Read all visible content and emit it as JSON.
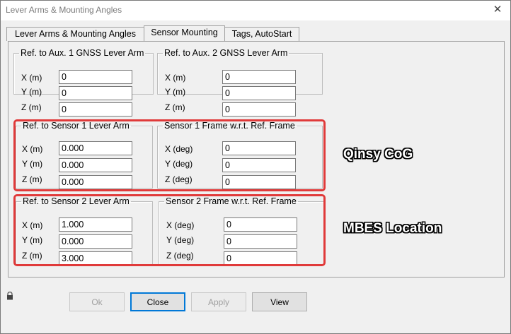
{
  "window": {
    "title": "Lever Arms & Mounting Angles",
    "close_glyph": "✕"
  },
  "tabs": [
    {
      "label": "Lever Arms & Mounting Angles",
      "active": false
    },
    {
      "label": "Sensor Mounting",
      "active": true
    },
    {
      "label": "Tags, AutoStart",
      "active": false
    }
  ],
  "groups": {
    "aux1": {
      "title": "Ref. to Aux. 1 GNSS Lever Arm",
      "rows": [
        {
          "label": "X (m)",
          "value": "0"
        },
        {
          "label": "Y (m)",
          "value": "0"
        },
        {
          "label": "Z (m)",
          "value": "0"
        }
      ]
    },
    "aux2": {
      "title": "Ref. to Aux. 2 GNSS Lever Arm",
      "rows": [
        {
          "label": "X (m)",
          "value": "0"
        },
        {
          "label": "Y (m)",
          "value": "0"
        },
        {
          "label": "Z (m)",
          "value": "0"
        }
      ]
    },
    "sensor1_arm": {
      "title": "Ref. to Sensor 1 Lever Arm",
      "rows": [
        {
          "label": "X (m)",
          "value": "0.000"
        },
        {
          "label": "Y (m)",
          "value": "0.000"
        },
        {
          "label": "Z (m)",
          "value": "0.000"
        }
      ]
    },
    "sensor1_frame": {
      "title": "Sensor 1 Frame w.r.t. Ref. Frame",
      "rows": [
        {
          "label": "X (deg)",
          "value": "0"
        },
        {
          "label": "Y (deg)",
          "value": "0"
        },
        {
          "label": "Z (deg)",
          "value": "0"
        }
      ]
    },
    "sensor2_arm": {
      "title": "Ref. to Sensor 2 Lever Arm",
      "rows": [
        {
          "label": "X (m)",
          "value": "1.000"
        },
        {
          "label": "Y (m)",
          "value": "0.000"
        },
        {
          "label": "Z (m)",
          "value": "3.000"
        }
      ]
    },
    "sensor2_frame": {
      "title": "Sensor 2 Frame w.r.t. Ref. Frame",
      "rows": [
        {
          "label": "X (deg)",
          "value": "0"
        },
        {
          "label": "Y (deg)",
          "value": "0"
        },
        {
          "label": "Z (deg)",
          "value": "0"
        }
      ]
    }
  },
  "annotations": {
    "sensor1": "Qinsy CoG",
    "sensor2": "MBES Location",
    "highlight_color": "#e03a3a"
  },
  "buttons": {
    "ok": "Ok",
    "close": "Close",
    "apply": "Apply",
    "view": "View"
  },
  "icons": {
    "status": "lock-icon"
  }
}
